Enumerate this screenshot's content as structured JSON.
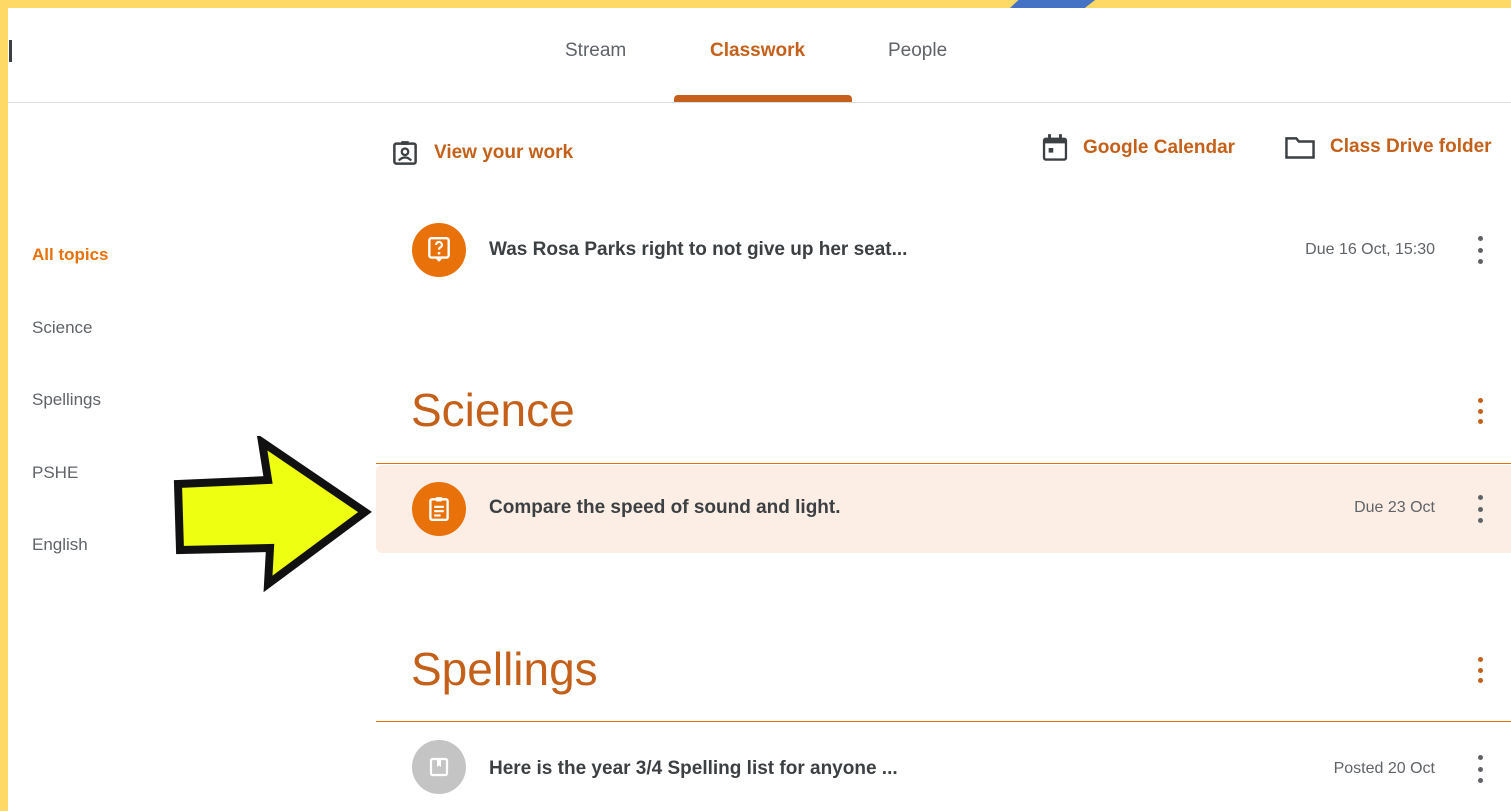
{
  "tabs": [
    {
      "label": "Stream",
      "active": false
    },
    {
      "label": "Classwork",
      "active": true
    },
    {
      "label": "People",
      "active": false
    }
  ],
  "toolbar": {
    "view_work": "View your work",
    "calendar": "Google Calendar",
    "drive": "Class Drive folder"
  },
  "sidebar": {
    "items": [
      {
        "label": "All topics",
        "active": true
      },
      {
        "label": "Science",
        "active": false
      },
      {
        "label": "Spellings",
        "active": false
      },
      {
        "label": "PSHE",
        "active": false
      },
      {
        "label": "English",
        "active": false
      }
    ]
  },
  "items": {
    "question": {
      "title": "Was Rosa Parks right to not give up her seat...",
      "due": "Due 16 Oct, 15:30",
      "icon": "question-icon"
    },
    "assignment": {
      "title": "Compare the speed of sound and light.",
      "due": "Due 23 Oct",
      "icon": "assignment-icon"
    },
    "material": {
      "title": "Here is the year 3/4 Spelling list for anyone ...",
      "due": "Posted 20 Oct",
      "icon": "material-icon"
    }
  },
  "topics": {
    "science": "Science",
    "spellings": "Spellings"
  },
  "colors": {
    "accent": "#c5601a",
    "icon_orange": "#e8710a",
    "highlight_bg": "#fdeee5",
    "frame_yellow": "#ffd966",
    "arrow_yellow": "#eeff11"
  }
}
